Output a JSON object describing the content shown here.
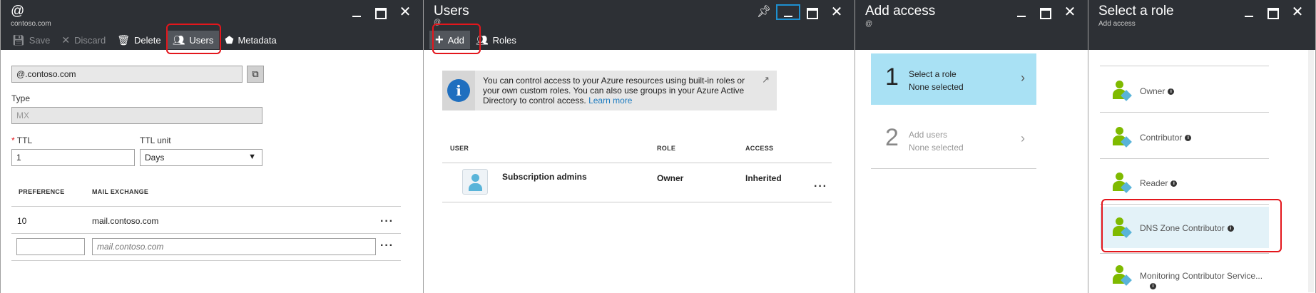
{
  "blade1": {
    "title": "@",
    "subtitle": "contoso.com",
    "toolbar": {
      "save": "Save",
      "discard": "Discard",
      "delete": "Delete",
      "users": "Users",
      "metadata": "Metadata"
    },
    "name_value": "@.contoso.com",
    "type_label": "Type",
    "type_value": "MX",
    "ttl_label": "TTL",
    "ttl_value": "1",
    "ttl_unit_label": "TTL unit",
    "ttl_unit_value": "Days",
    "table": {
      "col_preference": "PREFERENCE",
      "col_mail_exchange": "MAIL EXCHANGE",
      "rows": [
        {
          "preference": "10",
          "mail_exchange": "mail.contoso.com"
        }
      ],
      "new_row_placeholder": "mail.contoso.com"
    }
  },
  "blade2": {
    "title": "Users",
    "subtitle": "@",
    "toolbar": {
      "add": "Add",
      "roles": "Roles"
    },
    "info_text": "You can control access to your Azure resources using built-in roles or your own custom roles. You can also use groups in your Azure Active Directory to control access.",
    "info_link": "Learn more",
    "table": {
      "col_user": "USER",
      "col_role": "ROLE",
      "col_access": "ACCESS",
      "rows": [
        {
          "user": "Subscription admins",
          "role": "Owner",
          "access": "Inherited"
        }
      ]
    }
  },
  "blade3": {
    "title": "Add access",
    "subtitle": "@",
    "steps": [
      {
        "number": "1",
        "title": "Select a role",
        "status": "None selected"
      },
      {
        "number": "2",
        "title": "Add users",
        "status": "None selected"
      }
    ]
  },
  "blade4": {
    "title": "Select a role",
    "subtitle": "Add access",
    "roles": [
      {
        "name": "Owner"
      },
      {
        "name": "Contributor"
      },
      {
        "name": "Reader"
      },
      {
        "name": "DNS Zone Contributor"
      },
      {
        "name": "Monitoring Contributor Service..."
      }
    ]
  },
  "colors": {
    "header_bg": "#2d3035",
    "highlight_red": "#e3161c",
    "active_step": "#a9e1f4",
    "selected_role": "#e3f2f8",
    "link": "#1a7abf",
    "info_icon": "#1f6fbf",
    "role_icon_green": "#7fba00",
    "role_icon_blue": "#59b4d9"
  }
}
